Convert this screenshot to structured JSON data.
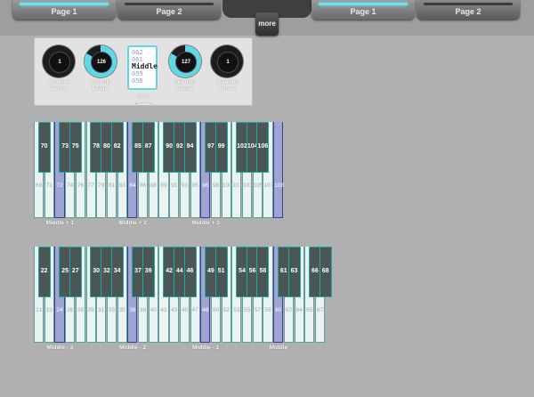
{
  "tabs": {
    "left": [
      {
        "label": "Page 1",
        "active": true
      },
      {
        "label": "Page 2",
        "active": false
      }
    ],
    "right": [
      {
        "label": "Page 1",
        "active": true
      },
      {
        "label": "Page 2",
        "active": false
      }
    ],
    "more_label": "more"
  },
  "controls": {
    "knobs": [
      {
        "value": "1",
        "label": "Channel Below",
        "lit": false
      },
      {
        "value": "126",
        "label": "Velocity Below",
        "lit": true
      },
      {
        "value": "127",
        "label": "Velocity Above",
        "lit": true
      },
      {
        "value": "1",
        "label": "Channel Above",
        "lit": false
      }
    ],
    "split": {
      "options": [
        "062",
        "061",
        "Middle",
        "059",
        "058"
      ],
      "selected": "Middle",
      "label": "Split",
      "arrow": "← · · · · · · →"
    }
  },
  "upper_keyboard": {
    "white_keys": [
      "69",
      "71",
      "72",
      "74",
      "76",
      "77",
      "79",
      "81",
      "83",
      "84",
      "86",
      "88",
      "89",
      "91",
      "93",
      "95",
      "96",
      "98",
      "100",
      "101",
      "103",
      "105",
      "107",
      "108"
    ],
    "black_keys": [
      "70",
      "73",
      "75",
      "78",
      "80",
      "82",
      "85",
      "87",
      "90",
      "92",
      "94",
      "97",
      "99",
      "102",
      "104",
      "106"
    ],
    "highlight": [
      "72",
      "84",
      "96",
      "108"
    ],
    "octave_labels": [
      "Middle + 1",
      "Middle + 2",
      "Middle + 3"
    ]
  },
  "lower_keyboard": {
    "white_keys": [
      "21",
      "23",
      "24",
      "26",
      "28",
      "29",
      "31",
      "33",
      "35",
      "36",
      "38",
      "40",
      "41",
      "43",
      "45",
      "47",
      "48",
      "50",
      "52",
      "53",
      "55",
      "57",
      "59",
      "60",
      "62",
      "64",
      "65",
      "67"
    ],
    "black_keys": [
      "22",
      "25",
      "27",
      "30",
      "32",
      "34",
      "37",
      "39",
      "42",
      "44",
      "46",
      "49",
      "51",
      "54",
      "56",
      "58",
      "61",
      "63",
      "66",
      "68"
    ],
    "highlight": [
      "24",
      "36",
      "48",
      "60"
    ],
    "octave_labels": [
      "Middle - 3",
      "Middle - 2",
      "Middle - 1",
      "Middle"
    ]
  },
  "colors": {
    "accent": "#5ed8e6",
    "key_highlight": "#9fa4d4",
    "black_key": "#4b5757"
  }
}
